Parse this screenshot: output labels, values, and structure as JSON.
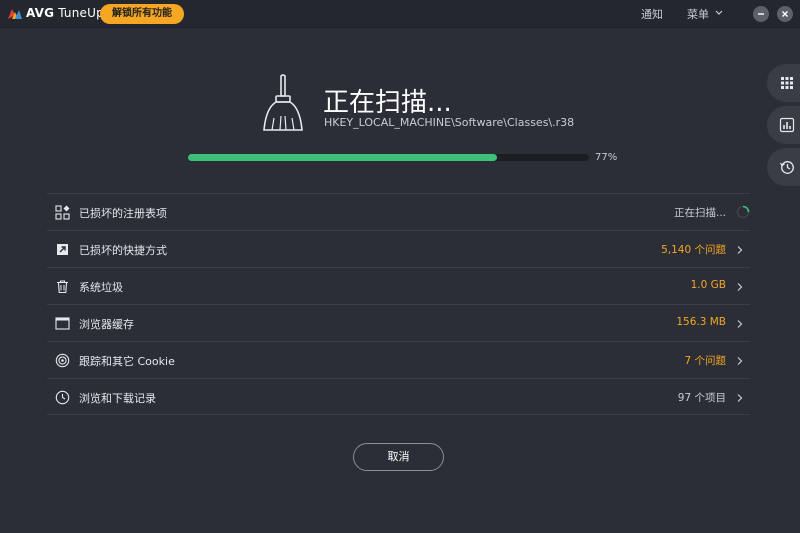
{
  "titlebar": {
    "brand": "AVG",
    "product": "TuneUp",
    "unlock_label": "解锁所有功能",
    "notify_label": "通知",
    "menu_label": "菜单"
  },
  "scan": {
    "title": "正在扫描...",
    "path": "HKEY_LOCAL_MACHINE\\Software\\Classes\\.r38",
    "progress_percent": 77,
    "progress_label": "77%"
  },
  "items": [
    {
      "icon": "registry-icon",
      "label": "已损坏的注册表项",
      "value": "正在扫描...",
      "state": "scanning"
    },
    {
      "icon": "shortcut-icon",
      "label": "已损坏的快捷方式",
      "value": "5,140 个问题",
      "state": "issue"
    },
    {
      "icon": "trash-icon",
      "label": "系统垃圾",
      "value": "1.0 GB",
      "state": "issue"
    },
    {
      "icon": "browser-window-icon",
      "label": "浏览器缓存",
      "value": "156.3 MB",
      "state": "issue"
    },
    {
      "icon": "target-icon",
      "label": "跟踪和其它 Cookie",
      "value": "7 个问题",
      "state": "issue"
    },
    {
      "icon": "clock-icon",
      "label": "浏览和下载记录",
      "value": "97 个项目",
      "state": "plain"
    }
  ],
  "cancel_label": "取消",
  "colors": {
    "accent_orange": "#f5a623",
    "progress_green": "#3ec07a",
    "background": "#2b2e36"
  }
}
